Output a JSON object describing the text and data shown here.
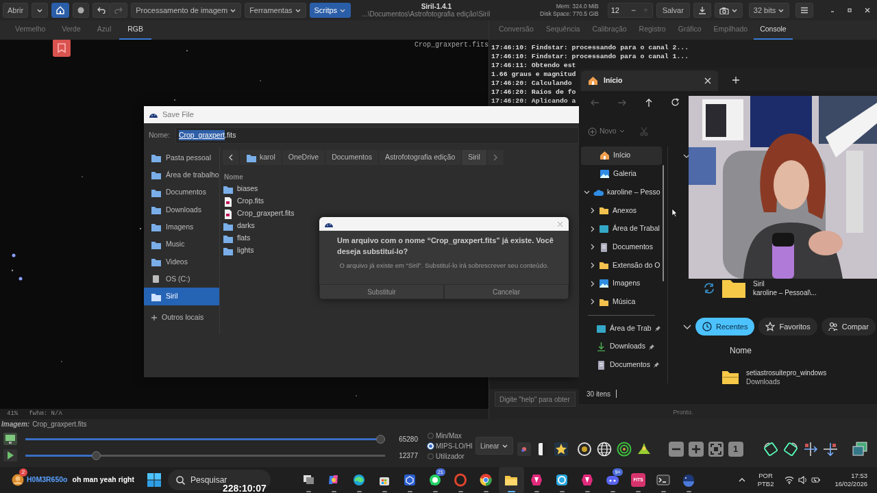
{
  "app": {
    "title": "Siril-1.4.1",
    "path": "...\\Documentos\\Astrofotografia edição\\Siril",
    "memory": "Mem: 324.0 MiB",
    "disk": "Disk Space: 770.5 GiB",
    "open": "Abrir",
    "home_active": true,
    "menus": [
      {
        "label": "Processamento de imagem",
        "selected": false
      },
      {
        "label": "Ferramentas",
        "selected": false
      },
      {
        "label": "Scritps",
        "selected": true
      }
    ],
    "spin": {
      "value": "12",
      "minus": "−",
      "plus": "+",
      "plus_disabled": true
    },
    "save": "Salvar",
    "bit_depth": "32 bits"
  },
  "channels": [
    {
      "label": "Vermelho",
      "selected": false
    },
    {
      "label": "Verde",
      "selected": false
    },
    {
      "label": "Azul",
      "selected": false
    },
    {
      "label": "RGB",
      "selected": true
    }
  ],
  "image": {
    "filename": "Crop_graxpert.fits",
    "zoom": "41%",
    "fwhm": "fwhm: N/A",
    "caption_label": "Imagem:",
    "caption_file": "Crop_graxpert.fits"
  },
  "panel_tabs": [
    {
      "label": "Conversão",
      "selected": false
    },
    {
      "label": "Sequência",
      "selected": false
    },
    {
      "label": "Calibração",
      "selected": false
    },
    {
      "label": "Registro",
      "selected": false
    },
    {
      "label": "Gráfico",
      "selected": false
    },
    {
      "label": "Empilhado",
      "selected": false
    },
    {
      "label": "Console",
      "selected": true
    }
  ],
  "console": {
    "lines": [
      "17:46:10: Findstar: processando para o canal 2...",
      "17:46:10: Findstar: processando para o canal 1...",
      "17:46:11: Obtendo est",
      "1.66 graus e magnitud",
      "17:46:20: Calculando",
      "17:46:20: Raios de fo",
      "17:46:20: Aplicando a"
    ],
    "placeholder": "Digite \"help\" para obter",
    "status": "Pronto."
  },
  "sliders": [
    {
      "value": "65280",
      "level": 1.0
    },
    {
      "value": "12377",
      "level": 0.19
    }
  ],
  "scale_modes": [
    {
      "label": "Min/Max",
      "selected": false
    },
    {
      "label": "MIPS-LO/HI",
      "selected": true
    },
    {
      "label": "Utilizador",
      "selected": false
    }
  ],
  "stretch": "Linear",
  "zoom_one": "1",
  "save_dialog": {
    "title": "Save File",
    "name_label": "Nome:",
    "name_selected": "Crop_graxpert",
    "name_rest": ".fits",
    "places": [
      {
        "label": "Pasta pessoal",
        "kind": "folder",
        "selected": false
      },
      {
        "label": "Área de trabalho",
        "kind": "folder",
        "selected": false
      },
      {
        "label": "Documentos",
        "kind": "folder",
        "selected": false
      },
      {
        "label": "Downloads",
        "kind": "folder",
        "selected": false
      },
      {
        "label": "Imagens",
        "kind": "folder",
        "selected": false
      },
      {
        "label": "Music",
        "kind": "folder",
        "selected": false
      },
      {
        "label": "Videos",
        "kind": "folder",
        "selected": false
      },
      {
        "label": "OS (C:)",
        "kind": "drive",
        "selected": false
      },
      {
        "label": "Siril",
        "kind": "folder",
        "selected": true
      }
    ],
    "other": "Outros locais",
    "path": [
      {
        "label": "karol",
        "kind": "home"
      },
      {
        "label": "OneDrive",
        "kind": "plain"
      },
      {
        "label": "Documentos",
        "kind": "plain"
      },
      {
        "label": "Astrofotografia edição",
        "kind": "plain"
      },
      {
        "label": "Siril",
        "kind": "current"
      }
    ],
    "column": "Nome",
    "files": [
      {
        "name": "biases",
        "kind": "folder"
      },
      {
        "name": "Crop.fits",
        "kind": "file"
      },
      {
        "name": "Crop_graxpert.fits",
        "kind": "file"
      },
      {
        "name": "darks",
        "kind": "folder"
      },
      {
        "name": "flats",
        "kind": "folder"
      },
      {
        "name": "lights",
        "kind": "folder"
      }
    ]
  },
  "confirm": {
    "heading": "Um arquivo com o nome “Crop_graxpert.fits” já existe. Você deseja substituí-lo?",
    "message": "O arquivo já existe em “Siril”. Substituí-lo irá sobrescrever seu conteúdo.",
    "buttons": [
      "Substituir",
      "Cancelar"
    ]
  },
  "explorer": {
    "tab": "Início",
    "new": "Novo",
    "tree": [
      {
        "label": "Início",
        "kind": "home",
        "selected": true
      },
      {
        "label": "Galeria",
        "kind": "gallery",
        "selected": false
      },
      {
        "label": "karoline – Pesso",
        "kind": "cloud",
        "selected": false,
        "expanded": true,
        "children": [
          {
            "label": "Anexos",
            "kind": "folder",
            "selected": false,
            "expanded": false
          },
          {
            "label": "Área de Trabal",
            "kind": "desktop",
            "selected": false,
            "expanded": false
          },
          {
            "label": "Documentos",
            "kind": "document",
            "selected": false,
            "expanded": false
          },
          {
            "label": "Extensão do O",
            "kind": "folder",
            "selected": false,
            "expanded": false
          },
          {
            "label": "Imagens",
            "kind": "gallery",
            "selected": false,
            "expanded": false
          },
          {
            "label": "Música",
            "kind": "folder",
            "selected": false,
            "expanded": false
          }
        ]
      }
    ],
    "pinned": [
      {
        "label": "Área de Trab",
        "kind": "desktop"
      },
      {
        "label": "Downloads",
        "kind": "download"
      },
      {
        "label": "Documentos",
        "kind": "document"
      }
    ],
    "count": "30 itens",
    "recent_folder": {
      "name": "Siril",
      "location": "karoline – Pessoal\\..."
    },
    "filters": [
      {
        "label": "Recentes",
        "kind": "clock",
        "selected": true
      },
      {
        "label": "Favoritos",
        "kind": "star",
        "selected": false
      },
      {
        "label": "Compar",
        "kind": "people",
        "selected": false
      }
    ],
    "column": "Nome",
    "items": [
      {
        "name": "setiastrosuitepro_windows",
        "location": "Downloads"
      }
    ]
  },
  "taskbar": {
    "notification": {
      "badge": "2",
      "user": "H0M3R650o",
      "message": "oh man yeah right"
    },
    "search": "Pesquisar",
    "timer": "228:10:07",
    "apps": [
      {
        "kind": "taskview",
        "selected": false
      },
      {
        "kind": "copilot",
        "selected": false
      },
      {
        "kind": "edge",
        "selected": false
      },
      {
        "kind": "store",
        "selected": false
      },
      {
        "kind": "cube",
        "selected": false
      },
      {
        "kind": "whatsapp",
        "selected": false,
        "badge": "21"
      },
      {
        "kind": "opera",
        "selected": false
      },
      {
        "kind": "chrome",
        "selected": false
      },
      {
        "kind": "explorer",
        "selected": true
      },
      {
        "kind": "affinity",
        "selected": false
      },
      {
        "kind": "sync",
        "selected": false
      },
      {
        "kind": "affinity",
        "selected": false
      },
      {
        "kind": "discord",
        "selected": false,
        "badge": "9+"
      },
      {
        "kind": "fits",
        "selected": false,
        "label": "FITS"
      },
      {
        "kind": "terminal",
        "selected": false
      },
      {
        "kind": "siril",
        "selected": false
      }
    ],
    "language": "POR",
    "layout": "PTB2",
    "time": "17:53",
    "date": "16/02/2026"
  }
}
